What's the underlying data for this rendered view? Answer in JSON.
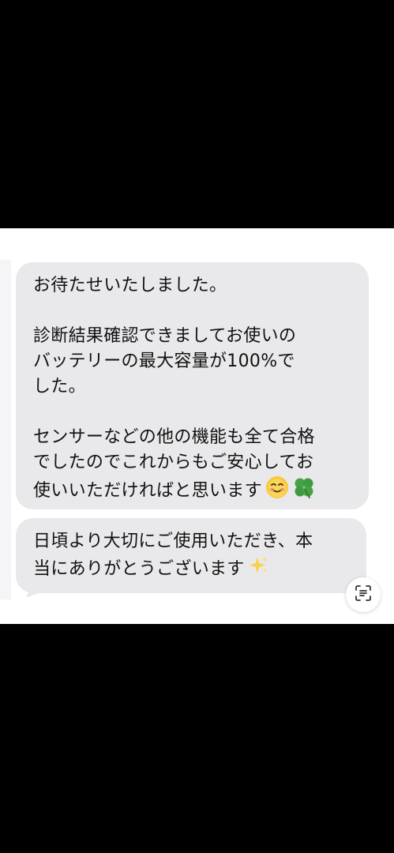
{
  "messages": [
    {
      "lines": [
        "お待たせいたしました。",
        "",
        "診断結果確認できましてお使いの",
        "バッテリーの最大容量が100%で",
        "した。",
        "",
        "センサーなどの他の機能も全て合格",
        "でしたのでこれからもご安心してお",
        "使いいただければと思います"
      ],
      "emoji": [
        "smiling-face-icon",
        "four-leaf-clover-icon"
      ]
    },
    {
      "lines": [
        "日頃より大切にご使用いただき、本",
        "当にありがとうございます"
      ],
      "emoji": [
        "sparkles-icon"
      ]
    }
  ],
  "colors": {
    "background": "#000000",
    "screen": "#ffffff",
    "bubble": "#e9e9eb",
    "text": "#111111"
  },
  "controls": {
    "scan_icon": "live-text-scan-icon"
  }
}
